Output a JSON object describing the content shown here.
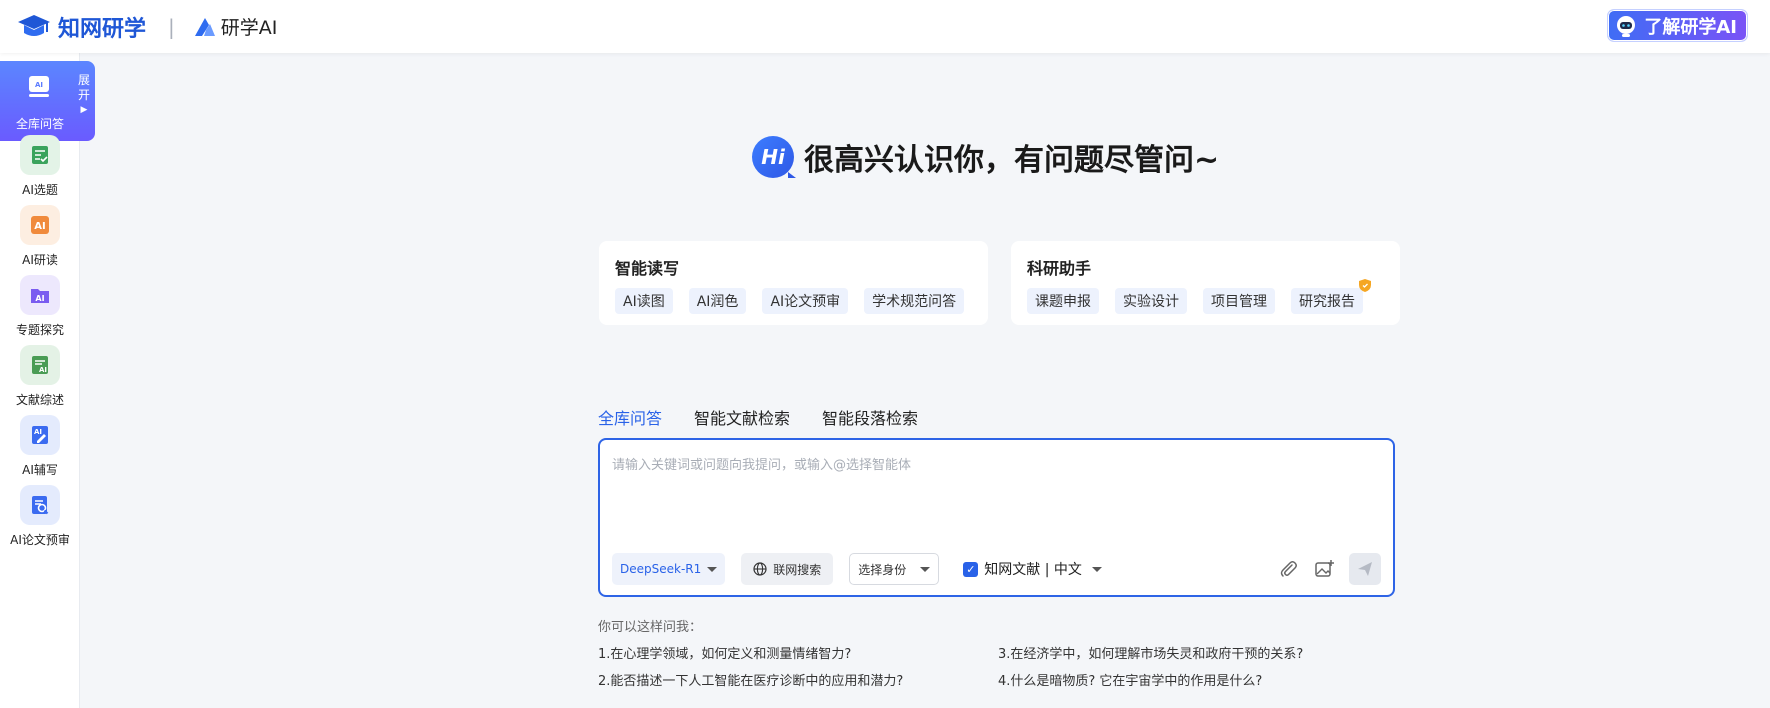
{
  "header": {
    "logo_text": "知网研学",
    "separator": "|",
    "sub_logo_text": "研学AI",
    "learn_button": "了解研学AI"
  },
  "sidebar": {
    "active": {
      "label": "全库问答",
      "expand_label": "展开",
      "icon": "ai-chat-icon"
    },
    "items": [
      {
        "label": "AI选题",
        "icon": "topic-icon",
        "color": "#3aa35c",
        "bg": "#e3f3e7"
      },
      {
        "label": "AI研读",
        "icon": "reading-icon",
        "color": "#f08a3c",
        "bg": "#fdeee1"
      },
      {
        "label": "专题探究",
        "icon": "folder-ai-icon",
        "color": "#7a5cf0",
        "bg": "#ede8fd"
      },
      {
        "label": "文献综述",
        "icon": "review-icon",
        "color": "#4a9c55",
        "bg": "#e4f2e6"
      },
      {
        "label": "AI辅写",
        "icon": "write-icon",
        "color": "#3b6bf0",
        "bg": "#e4ebfd"
      },
      {
        "label": "AI论文预审",
        "icon": "paper-review-icon",
        "color": "#3b6bf0",
        "bg": "#e4ebfd"
      }
    ]
  },
  "hero": {
    "badge": "Hi",
    "text": "很高兴认识你，有问题尽管问~"
  },
  "cards": [
    {
      "title": "智能读写",
      "chips": [
        "AI读图",
        "AI润色",
        "AI论文预审",
        "学术规范问答"
      ]
    },
    {
      "title": "科研助手",
      "chips": [
        "课题申报",
        "实验设计",
        "项目管理",
        "研究报告"
      ]
    }
  ],
  "tabs": [
    "全库问答",
    "智能文献检索",
    "智能段落检索"
  ],
  "input": {
    "placeholder": "请输入关键词或问题向我提问，或输入@选择智能体",
    "model": "DeepSeek-R1",
    "web_search": "联网搜索",
    "role": "选择身份",
    "source": "知网文献 | 中文"
  },
  "suggestions": {
    "title": "你可以这样问我：",
    "items": [
      "1.在心理学领域，如何定义和测量情绪智力?",
      "2.能否描述一下人工智能在医疗诊断中的应用和潜力?",
      "3.在经济学中，如何理解市场失灵和政府干预的关系?",
      "4.什么是暗物质? 它在宇宙学中的作用是什么?"
    ]
  },
  "colors": {
    "primary": "#2962e8",
    "accent_gradient_start": "#5b86ff",
    "accent_gradient_end": "#6a5bff"
  }
}
